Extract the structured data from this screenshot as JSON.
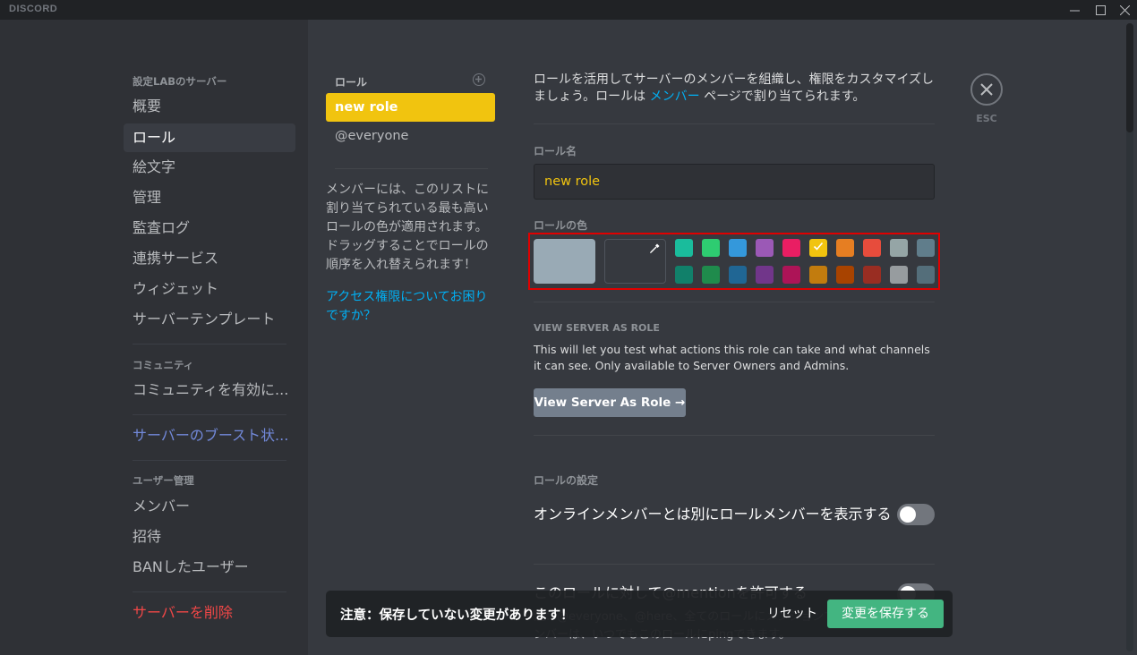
{
  "titlebar": {
    "app_name": "DISCORD",
    "minimize": "—",
    "maximize": "☐",
    "close": "✕"
  },
  "sidebar": {
    "server_header": "設定LABのサーバー",
    "items": [
      {
        "label": "概要"
      },
      {
        "label": "ロール",
        "active": true
      },
      {
        "label": "絵文字"
      },
      {
        "label": "管理"
      },
      {
        "label": "監査ログ"
      },
      {
        "label": "連携サービス"
      },
      {
        "label": "ウィジェット"
      },
      {
        "label": "サーバーテンプレート"
      }
    ],
    "community_header": "コミュニティ",
    "community_item": "コミュニティを有効に...",
    "boost_item": "サーバーのブースト状...",
    "user_mgmt_header": "ユーザー管理",
    "user_items": [
      {
        "label": "メンバー"
      },
      {
        "label": "招待"
      },
      {
        "label": "BANしたユーザー"
      }
    ],
    "delete_server": "サーバーを削除"
  },
  "roles": {
    "header": "ロール",
    "add_icon": "plus-circle-icon",
    "list": [
      {
        "label": "new role",
        "selected": true,
        "color": "#f1c40f"
      },
      {
        "label": "@everyone",
        "selected": false
      }
    ],
    "help_text": "メンバーには、このリストに割り当てられている最も高いロールの色が適用されます。ドラッグすることでロールの順序を入れ替えられます！",
    "help_link": "アクセス権限についてお困りですか？"
  },
  "main": {
    "intro_part1": "ロールを活用してサーバーのメンバーを組織し、権限をカスタマイズしましょう。ロールは ",
    "intro_link": "メンバー",
    "intro_part2": " ページで割り当てられます。",
    "role_name_label": "ロール名",
    "role_name_value": "new role",
    "role_color_label": "ロールの色",
    "default_color": "#99aab5",
    "selected_color": "#f1c40f",
    "color_swatches_row1": [
      "#1abc9c",
      "#2ecc71",
      "#3498db",
      "#9b59b6",
      "#e91e63",
      "#f1c40f",
      "#e67e22",
      "#e74c3c",
      "#95a5a6",
      "#607d8b"
    ],
    "color_swatches_row2": [
      "#11806a",
      "#1f8b4c",
      "#206694",
      "#71368a",
      "#ad1457",
      "#c27c0e",
      "#a84300",
      "#992d22",
      "#979c9f",
      "#546e7a"
    ],
    "view_as_role_header": "VIEW SERVER AS ROLE",
    "view_as_role_desc": "This will let you test what actions this role can take and what channels it can see. Only available to Server Owners and Admins.",
    "view_as_role_button": "View Server As Role →",
    "role_settings_header": "ロールの設定",
    "settings": [
      {
        "label": "オンラインメンバーとは別にロールメンバーを表示する",
        "enabled": false
      },
      {
        "label": "このロールに対して@mentionを許可する",
        "enabled": false,
        "note": "注：@everyone、@here、全てのロールにメンションできる権限のあるメンバーは、いつでもこのロールにpingできます。"
      }
    ]
  },
  "close": {
    "label": "ESC"
  },
  "notice": {
    "text": "注意：保存していない変更があります！",
    "reset": "リセット",
    "save": "変更を保存する"
  }
}
